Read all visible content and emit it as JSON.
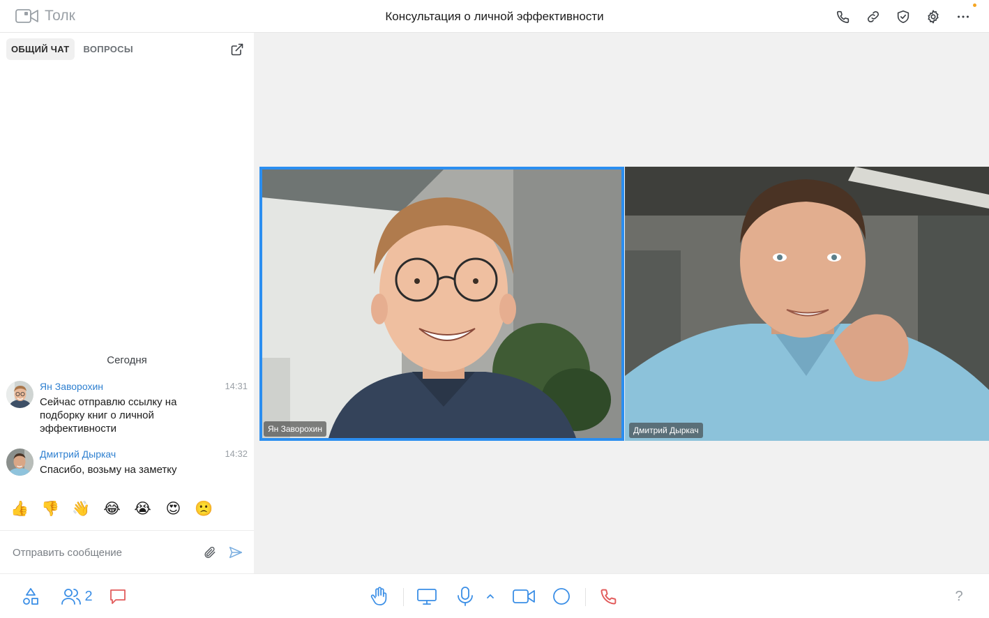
{
  "app": {
    "name": "Толк",
    "call_title": "Консультация о личной эффективности"
  },
  "header_icons": [
    "phone-icon",
    "link-icon",
    "shield-check-icon",
    "gear-icon",
    "more-dots-icon"
  ],
  "sidebar": {
    "tabs": [
      {
        "label": "ОБЩИЙ ЧАТ",
        "active": true
      },
      {
        "label": "ВОПРОСЫ",
        "active": false
      }
    ],
    "date_separator": "Сегодня",
    "messages": [
      {
        "author": "Ян Заворохин",
        "time": "14:31",
        "text": "Сейчас отправлю ссылку на подборку книг о личной эффективности"
      },
      {
        "author": "Дмитрий Дыркач",
        "time": "14:32",
        "text": "Спасибо, возьму на заметку"
      }
    ],
    "reactions": [
      "👍",
      "👎",
      "👋",
      "😂",
      "😭",
      "😍",
      "🙁"
    ],
    "composer": {
      "placeholder": "Отправить сообщение"
    }
  },
  "participants": [
    {
      "name": "Ян Заворохин",
      "active_speaker": true
    },
    {
      "name": "Дмитрий Дыркач",
      "active_speaker": false
    }
  ],
  "toolbar": {
    "participants_count": "2",
    "help_label": "?"
  },
  "colors": {
    "accent": "#2b8ef0",
    "toolbar_icon": "#3a8ee6",
    "hangup": "#e25c5c",
    "author": "#2f80d0",
    "stage_bg": "#f1f1f1"
  }
}
